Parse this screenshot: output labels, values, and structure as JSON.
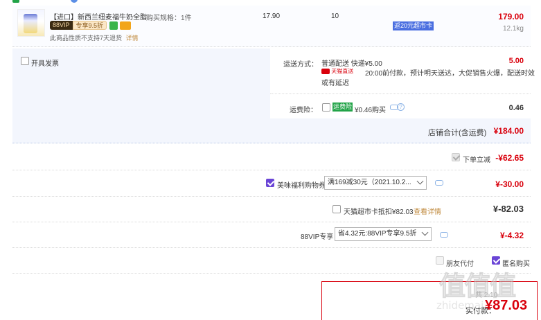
{
  "product": {
    "title": "【进口】新西兰纽麦福牛奶全脂...",
    "spec": "购买规格：1件",
    "vip_badge": "88VIP",
    "vip_discount": "专享9.5折",
    "no_return_notice": "此商品性质不支持7天退货",
    "detail_link": "详情",
    "unit_price": "17.90",
    "quantity": "10",
    "rebate_tag": "返20元超市卡",
    "subtotal": "179.00",
    "weight": "12.1kg"
  },
  "invoice": {
    "label": "开具发票"
  },
  "shipping": {
    "label": "运送方式：",
    "method": "普通配送 快递¥5.00",
    "fee": "5.00",
    "tmall_tag": "天猫直送",
    "note_line1": "20:00前付款，预计明天送达，大促销售火爆，配送时效",
    "note_line2": "或有延迟"
  },
  "insurance": {
    "label": "运费险：",
    "tag": "运费险",
    "text": "¥0.46购买",
    "amount": "0.46"
  },
  "store_total": {
    "label": "店铺合计(含运费)",
    "amount": "¥184.00"
  },
  "instant_discount": {
    "label": "下单立减",
    "amount": "-¥62.65"
  },
  "coupon": {
    "label": "美味福利购物券",
    "selected": "满169减30元（2021.10.2...",
    "amount": "¥-30.00"
  },
  "market_card": {
    "label": "天猫超市卡抵扣¥82.03",
    "link": "查看详情",
    "amount": "¥-82.03"
  },
  "vip88": {
    "label": "88VIP专享",
    "selected": "省4.32元:88VIP专享9.5折",
    "amount": "¥-4.32"
  },
  "options": {
    "friend_pay": "朋友代付",
    "anonymous": "匿名购买"
  },
  "footer": {
    "paid_label": "实付款：",
    "paid_amount": "¥87.03",
    "saved_prefix": "共",
    "saved_value": "2.10"
  },
  "watermark": "值 值 值",
  "watermark_sub": "zhidemai",
  "colors": {
    "price_red": "#d9000c",
    "accent_purple": "#6a45d6",
    "rebate_blue": "#4a6ee0",
    "link_orange": "#c08a3e",
    "green_tag": "#22a348"
  }
}
